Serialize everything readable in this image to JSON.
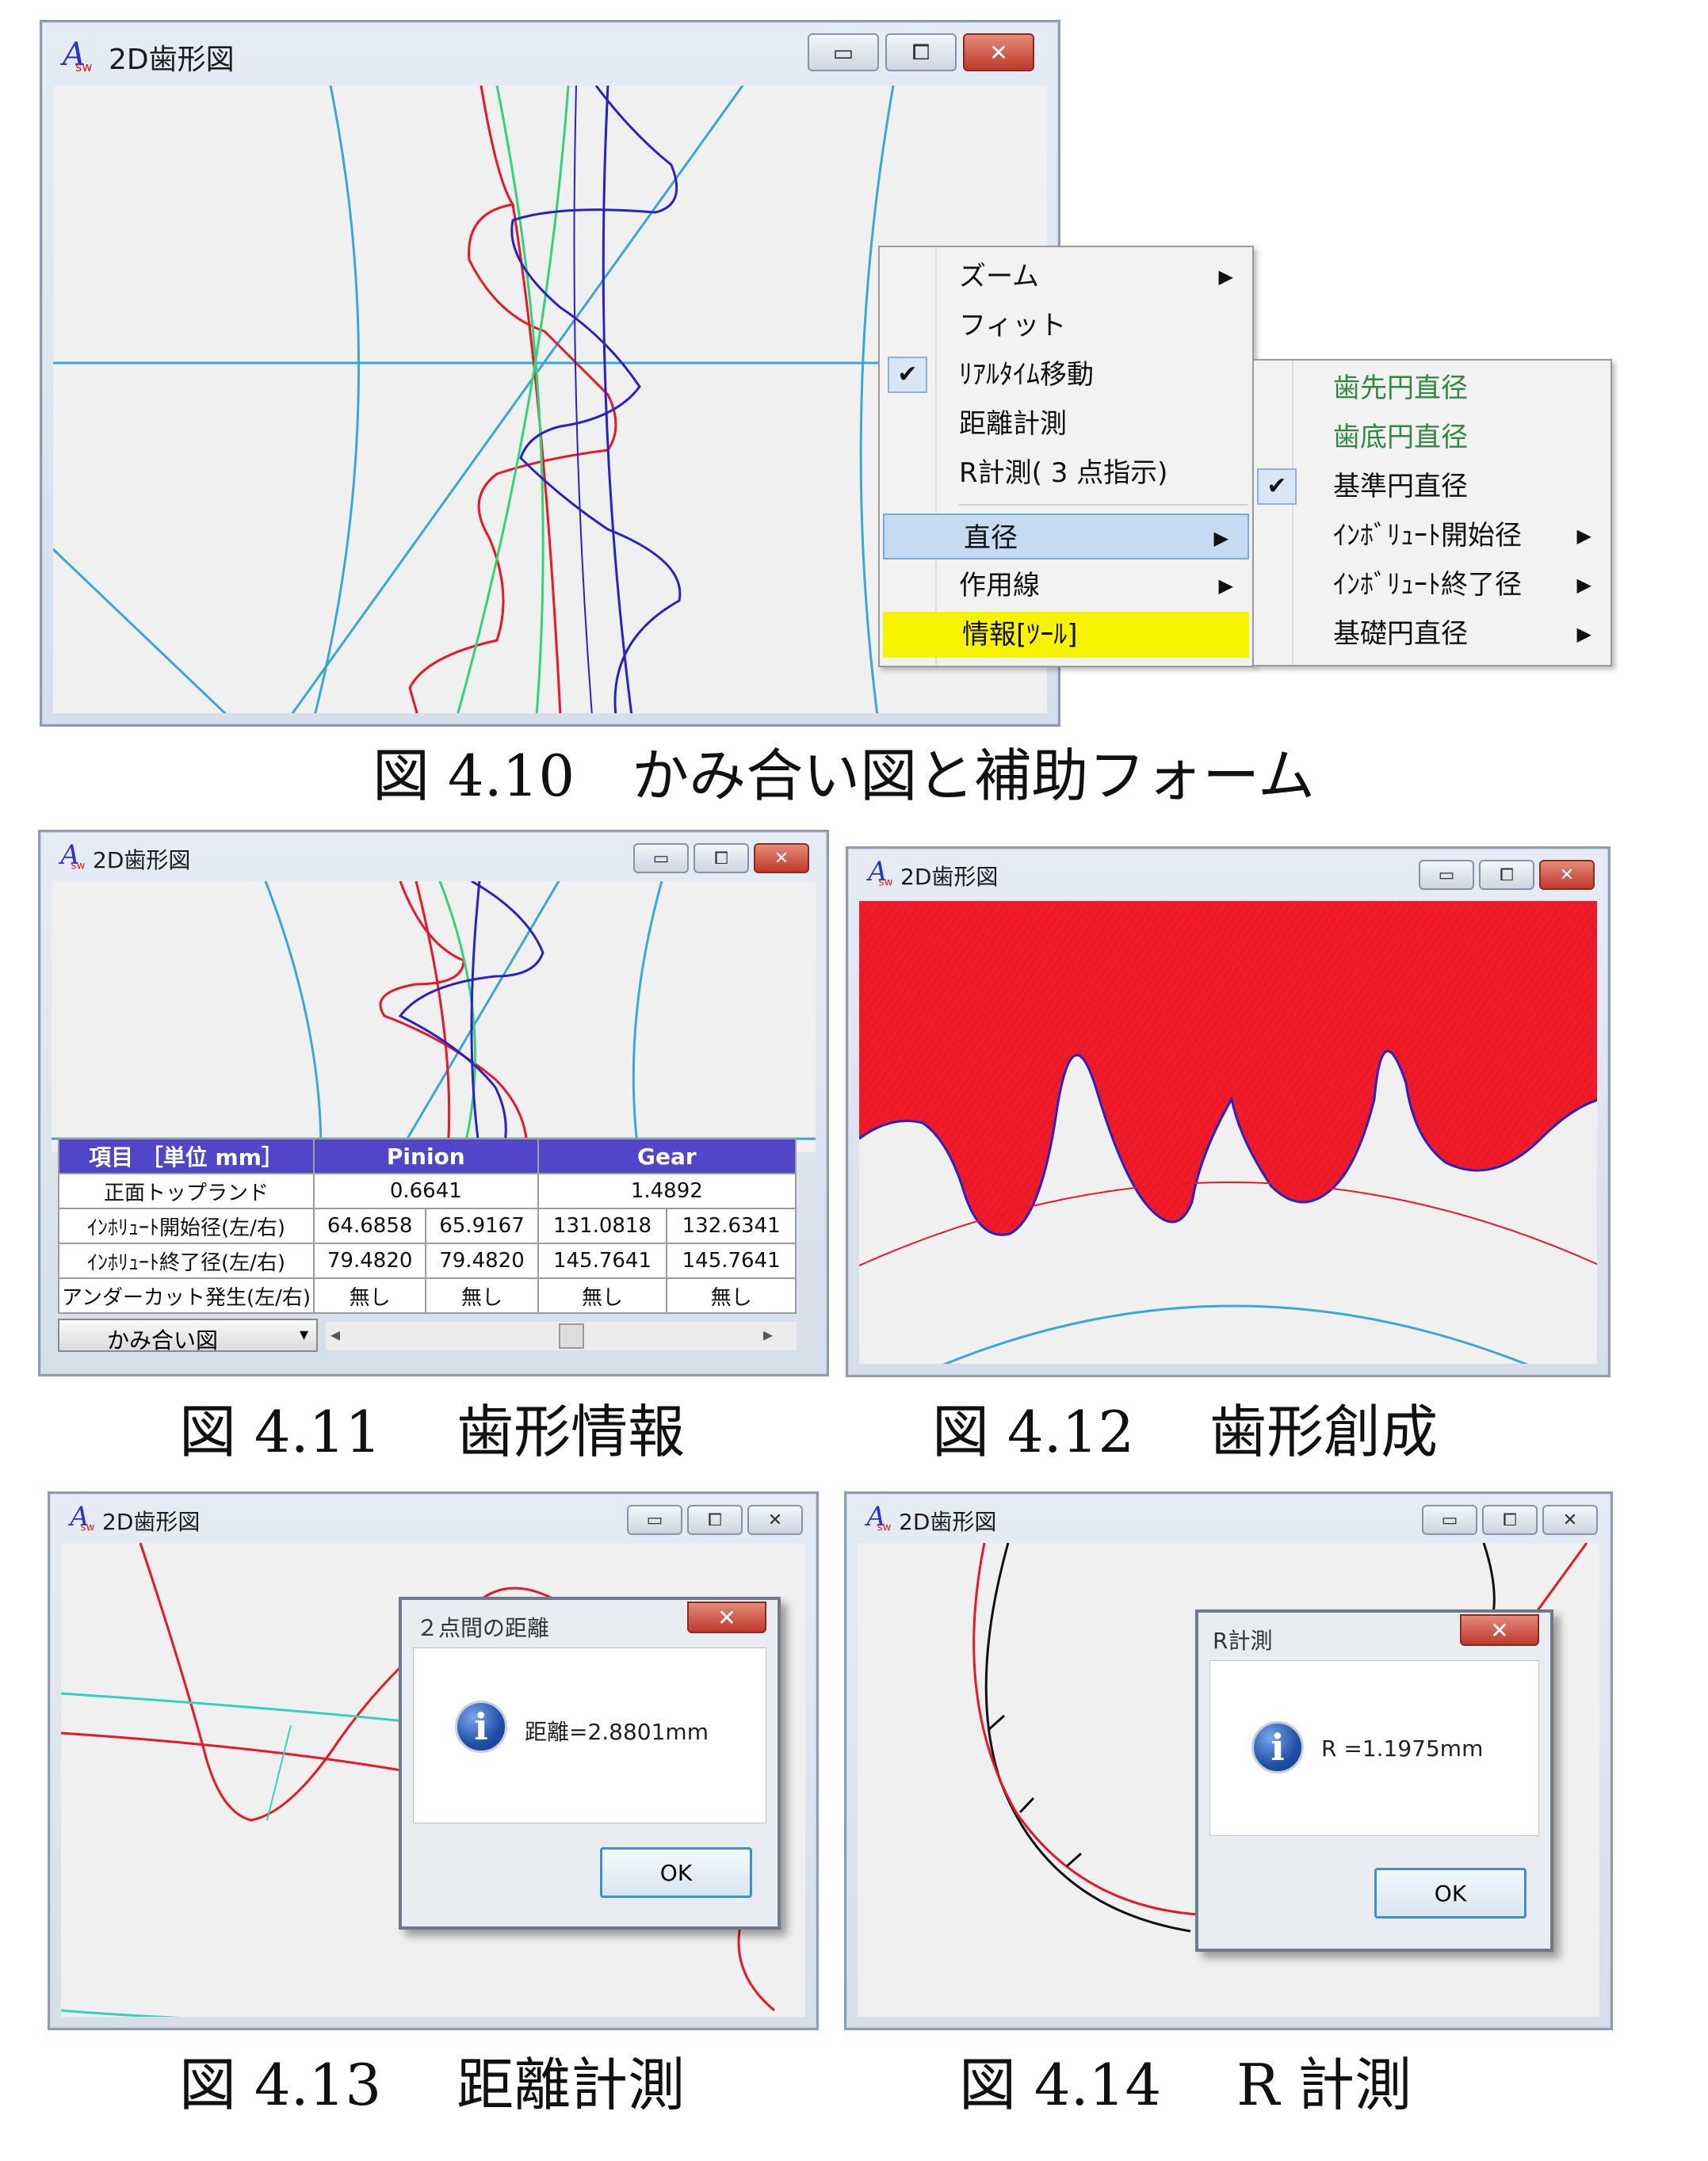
{
  "window_title": "2D歯形図",
  "window_buttons": {
    "minimize": "▭",
    "maximize": "⧠",
    "close": "✕"
  },
  "figures": {
    "fig410": "図 4.10　かみ合い図と補助フォーム",
    "fig411": "図 4.11　 歯形情報",
    "fig412": "図 4.12　 歯形創成",
    "fig413": "図 4.13　 距離計測",
    "fig414": "図 4.14　 R 計測"
  },
  "context_menu": {
    "items": [
      {
        "label": "ズーム",
        "has_submenu": true,
        "checked": false
      },
      {
        "label": "フィット",
        "has_submenu": false,
        "checked": false
      },
      {
        "label": "ﾘｱﾙﾀｲﾑ移動",
        "has_submenu": false,
        "checked": true
      },
      {
        "label": "距離計測",
        "has_submenu": false,
        "checked": false
      },
      {
        "label": "R計測( 3 点指示)",
        "has_submenu": false,
        "checked": false
      },
      {
        "label": "直径",
        "has_submenu": true,
        "checked": false,
        "highlighted": true
      },
      {
        "label": "作用線",
        "has_submenu": true,
        "checked": false
      },
      {
        "label": "情報[ﾂｰﾙ]",
        "has_submenu": false,
        "checked": false,
        "yellow": true
      }
    ],
    "check_mark": "✔",
    "arrow": "▶"
  },
  "sub_menu": {
    "items": [
      {
        "label": "歯先円直径",
        "color": "#2e8b3e",
        "has_submenu": false,
        "checked": false
      },
      {
        "label": "歯底円直径",
        "color": "#2e8b3e",
        "has_submenu": false,
        "checked": false
      },
      {
        "label": "基準円直径",
        "color": "#111111",
        "has_submenu": false,
        "checked": true
      },
      {
        "label": "ｲﾝﾎﾞﾘｭｰﾄ開始径",
        "color": "#111111",
        "has_submenu": true,
        "checked": false
      },
      {
        "label": "ｲﾝﾎﾞﾘｭｰﾄ終了径",
        "color": "#111111",
        "has_submenu": true,
        "checked": false
      },
      {
        "label": "基礎円直径",
        "color": "#111111",
        "has_submenu": true,
        "checked": false
      }
    ]
  },
  "info_table": {
    "headers": [
      "項目 ［単位 mm］",
      "Pinion",
      "Gear"
    ],
    "rows": [
      {
        "label": "正面トップランド",
        "pinion": "0.6641",
        "gear": "1.4892"
      },
      {
        "label": "ｲﾝﾎﾘｭｰﾄ開始径(左/右)",
        "pinion_l": "64.6858",
        "pinion_r": "65.9167",
        "gear_l": "131.0818",
        "gear_r": "132.6341"
      },
      {
        "label": "ｲﾝﾎﾘｭｰﾄ終了径(左/右)",
        "pinion_l": "79.4820",
        "pinion_r": "79.4820",
        "gear_l": "145.7641",
        "gear_r": "145.7641"
      },
      {
        "label": "アンダーカット発生(左/右)",
        "pinion_l": "無し",
        "pinion_r": "無し",
        "gear_l": "無し",
        "gear_r": "無し"
      }
    ],
    "view_select": "かみ合い図",
    "scroll_left": "◂",
    "scroll_right": "▸"
  },
  "distance_dialog": {
    "title": "２点間の距離",
    "message": "距離=2.8801mm",
    "ok": "OK",
    "close": "✕",
    "icon": "i"
  },
  "r_dialog": {
    "title": "R計測",
    "message": "R =1.1975mm",
    "ok": "OK",
    "close": "✕",
    "icon": "i"
  },
  "colors": {
    "pinion_red": "#e8172a",
    "gear_blue": "#2a22c8",
    "green": "#33d37a",
    "cyan": "#39a7d8",
    "header_purple": "#5146c9",
    "highlight_yellow": "#f8f400",
    "highlight_blue": "#c6dbf2"
  }
}
